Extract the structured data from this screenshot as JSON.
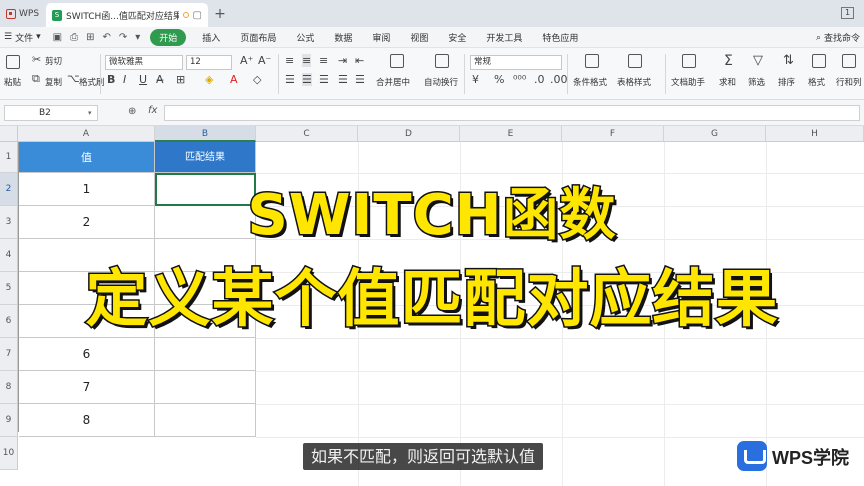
{
  "titlebar": {
    "app_name": "WPS",
    "doc_tab": "SWITCH函...值匹配对应结果",
    "new_tab": "+",
    "window_count": "1"
  },
  "menubar": {
    "file": "文件",
    "start": "开始",
    "items": [
      "插入",
      "页面布局",
      "公式",
      "数据",
      "审阅",
      "视图",
      "安全",
      "开发工具",
      "特色应用"
    ],
    "search": "查找命令"
  },
  "ribbon": {
    "paste": "粘贴",
    "cut": "剪切",
    "copy": "复制",
    "format_painter": "格式刷",
    "font_name": "微软雅黑",
    "font_size": "12",
    "merge_center": "合并居中",
    "wrap_text": "自动换行",
    "number_format": "常规",
    "cond_format": "条件格式",
    "table_style": "表格样式",
    "doc_helper": "文档助手",
    "sum": "求和",
    "filter": "筛选",
    "sort": "排序",
    "format": "格式",
    "row_col": "行和列"
  },
  "formula_bar": {
    "cell_ref": "B2",
    "fx": "fx",
    "value": ""
  },
  "grid": {
    "columns": [
      "A",
      "B",
      "C",
      "D",
      "E",
      "F",
      "G",
      "H"
    ],
    "rows": [
      "1",
      "2",
      "3",
      "4",
      "5",
      "6",
      "7",
      "8",
      "9",
      "10"
    ],
    "headers": {
      "a1": "值",
      "b1": "匹配结果"
    },
    "col_a_values": [
      "1",
      "2",
      "",
      "",
      "",
      "6",
      "7",
      "8"
    ]
  },
  "overlay": {
    "line1": "SWITCH函数",
    "line2": "定义某个值匹配对应结果"
  },
  "subtitle": "如果不匹配，则返回可选默认值",
  "watermark": "WPS学院",
  "colors": {
    "header_blue": "#3a8bd8",
    "accent_green": "#2e9b4f",
    "overlay_yellow": "#ffe600"
  }
}
